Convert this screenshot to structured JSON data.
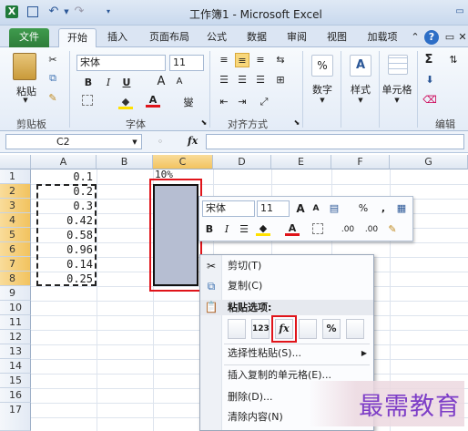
{
  "window": {
    "title": "工作簿1 - Microsoft Excel"
  },
  "quick_access": {
    "undo": "↶",
    "redo": "↷"
  },
  "tabs": [
    {
      "label": "文件"
    },
    {
      "label": "开始"
    },
    {
      "label": "插入"
    },
    {
      "label": "页面布局"
    },
    {
      "label": "公式"
    },
    {
      "label": "数据"
    },
    {
      "label": "审阅"
    },
    {
      "label": "视图"
    },
    {
      "label": "加载项"
    }
  ],
  "ribbon": {
    "paste_label": "粘贴",
    "font_name": "宋体",
    "font_size": "11",
    "bold": "B",
    "italic": "I",
    "underline": "U",
    "grow_font": "A",
    "shrink_font": "A",
    "phonetic": "燮",
    "number_label": "数字",
    "percent": "%",
    "style_label": "样式",
    "cells_label": "单元格",
    "sigma": "Σ",
    "groups": {
      "clipboard": "剪贴板",
      "font": "字体",
      "alignment": "对齐方式",
      "editing": "编辑"
    }
  },
  "formula_bar": {
    "name_box": "C2",
    "fx": "fx",
    "formula": ""
  },
  "columns": [
    "A",
    "B",
    "C",
    "D",
    "E",
    "F",
    "G"
  ],
  "rows": [
    "1",
    "2",
    "3",
    "4",
    "5",
    "6",
    "7",
    "8",
    "9",
    "10",
    "11",
    "12",
    "13",
    "14",
    "15",
    "16",
    "17"
  ],
  "cells": {
    "A": [
      "0.1",
      "0.2",
      "0.3",
      "0.42",
      "0.58",
      "0.96",
      "0.14",
      "0.25"
    ],
    "C1": "10%"
  },
  "mini_toolbar": {
    "font_name": "宋体",
    "font_size": "11",
    "percent": "%",
    "comma": ",",
    "inc_decimal": ".00",
    "dec_decimal": ".00",
    "bold": "B",
    "italic": "I"
  },
  "context_menu": {
    "cut": "剪切(T)",
    "copy": "复制(C)",
    "paste_options": "粘贴选项:",
    "paste_buttons": [
      "",
      "123",
      "fx",
      "",
      "%",
      ""
    ],
    "paste_special": "选择性粘贴(S)...",
    "insert_copied": "插入复制的单元格(E)...",
    "delete": "删除(D)...",
    "clear": "清除内容(N)"
  },
  "watermark": "最需教育",
  "colors": {
    "file_tab": "#2e7d3a",
    "selection": "#b6bed2",
    "highlight": "#e0141a",
    "watermark": "#7d3dc7"
  }
}
